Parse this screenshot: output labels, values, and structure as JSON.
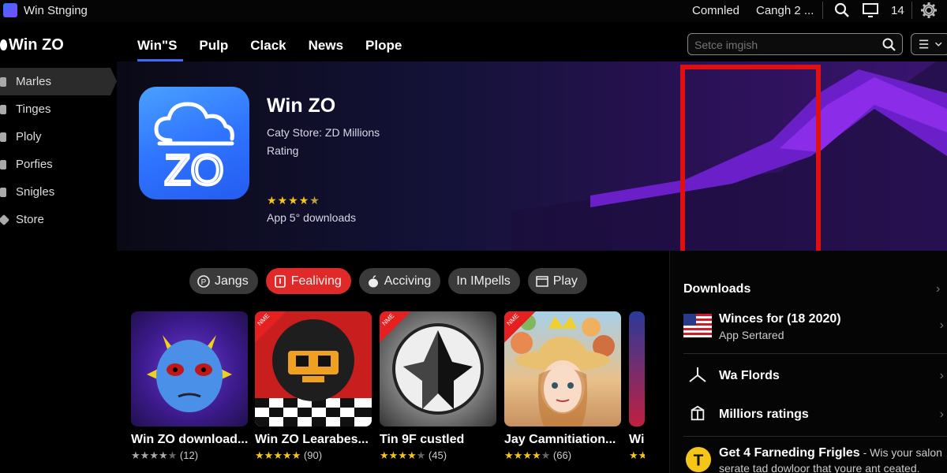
{
  "titlebar": {
    "app_title": "Win Stnging",
    "status_1": "Comnled",
    "status_2": "Cangh 2 ...",
    "count": "14"
  },
  "brand": {
    "name": "Win ZO"
  },
  "nav": {
    "tabs": [
      "Win\"S",
      "Pulp",
      "Clack",
      "News",
      "Plope"
    ],
    "active_index": 0
  },
  "search": {
    "placeholder": "Setce imgish"
  },
  "sidebar": {
    "items": [
      "Marles",
      "Tinges",
      "Ploly",
      "Porfies",
      "Snigles",
      "Store"
    ],
    "active_index": 0
  },
  "hero": {
    "title": "Win ZO",
    "subtitle": "Caty Store: ZD Millions",
    "rating_label": "Rating",
    "stars": 4.5,
    "downloads": "App 5° downloads",
    "icon_text": "ZO"
  },
  "chips": [
    {
      "label": "Jangs",
      "icon": "coin-icon",
      "active": false
    },
    {
      "label": "Fealiving",
      "icon": "bookmark-icon",
      "active": true
    },
    {
      "label": "Acciving",
      "icon": "apple-icon",
      "active": false
    },
    {
      "label": "In IMpells",
      "icon": "",
      "active": false
    },
    {
      "label": "Play",
      "icon": "window-icon",
      "active": false
    }
  ],
  "cards": [
    {
      "title": "Win ZO download...",
      "rating_text": "(12)",
      "stars": 4,
      "star_color": "gray",
      "badge": ""
    },
    {
      "title": "Win ZO Learabes...",
      "rating_text": "(90)",
      "stars": 5,
      "star_color": "gold",
      "badge": "NME"
    },
    {
      "title": "Tin 9F custled",
      "rating_text": "(45)",
      "stars": 4,
      "star_color": "gold",
      "badge": "NME"
    },
    {
      "title": "Jay Camnitiation...",
      "rating_text": "(66)",
      "stars": 4,
      "star_color": "gold",
      "badge": "NME"
    },
    {
      "title": "Wi",
      "rating_text": "",
      "stars": 2,
      "star_color": "gold",
      "badge": ""
    }
  ],
  "right_panel": {
    "heading": "Downloads",
    "rows": [
      {
        "title": "Winces for (18 2020)",
        "subtitle": "App Sertared",
        "icon": "us-flag-icon"
      },
      {
        "title": "Wa Flords",
        "subtitle": "",
        "icon": "tripod-icon"
      },
      {
        "title": "Milliors ratings",
        "subtitle": "",
        "icon": "box-icon"
      },
      {
        "title": "Get 4 Farneding Frigles",
        "title_suffix": " - Wis your salon",
        "subtitle": "serate tad dowloor that youre ant ceated.",
        "icon": "t-badge-icon"
      }
    ]
  },
  "colors": {
    "accent": "#3b6cff",
    "chip_active": "#e02a2a",
    "highlight": "#e01010",
    "star": "#f5c518"
  }
}
